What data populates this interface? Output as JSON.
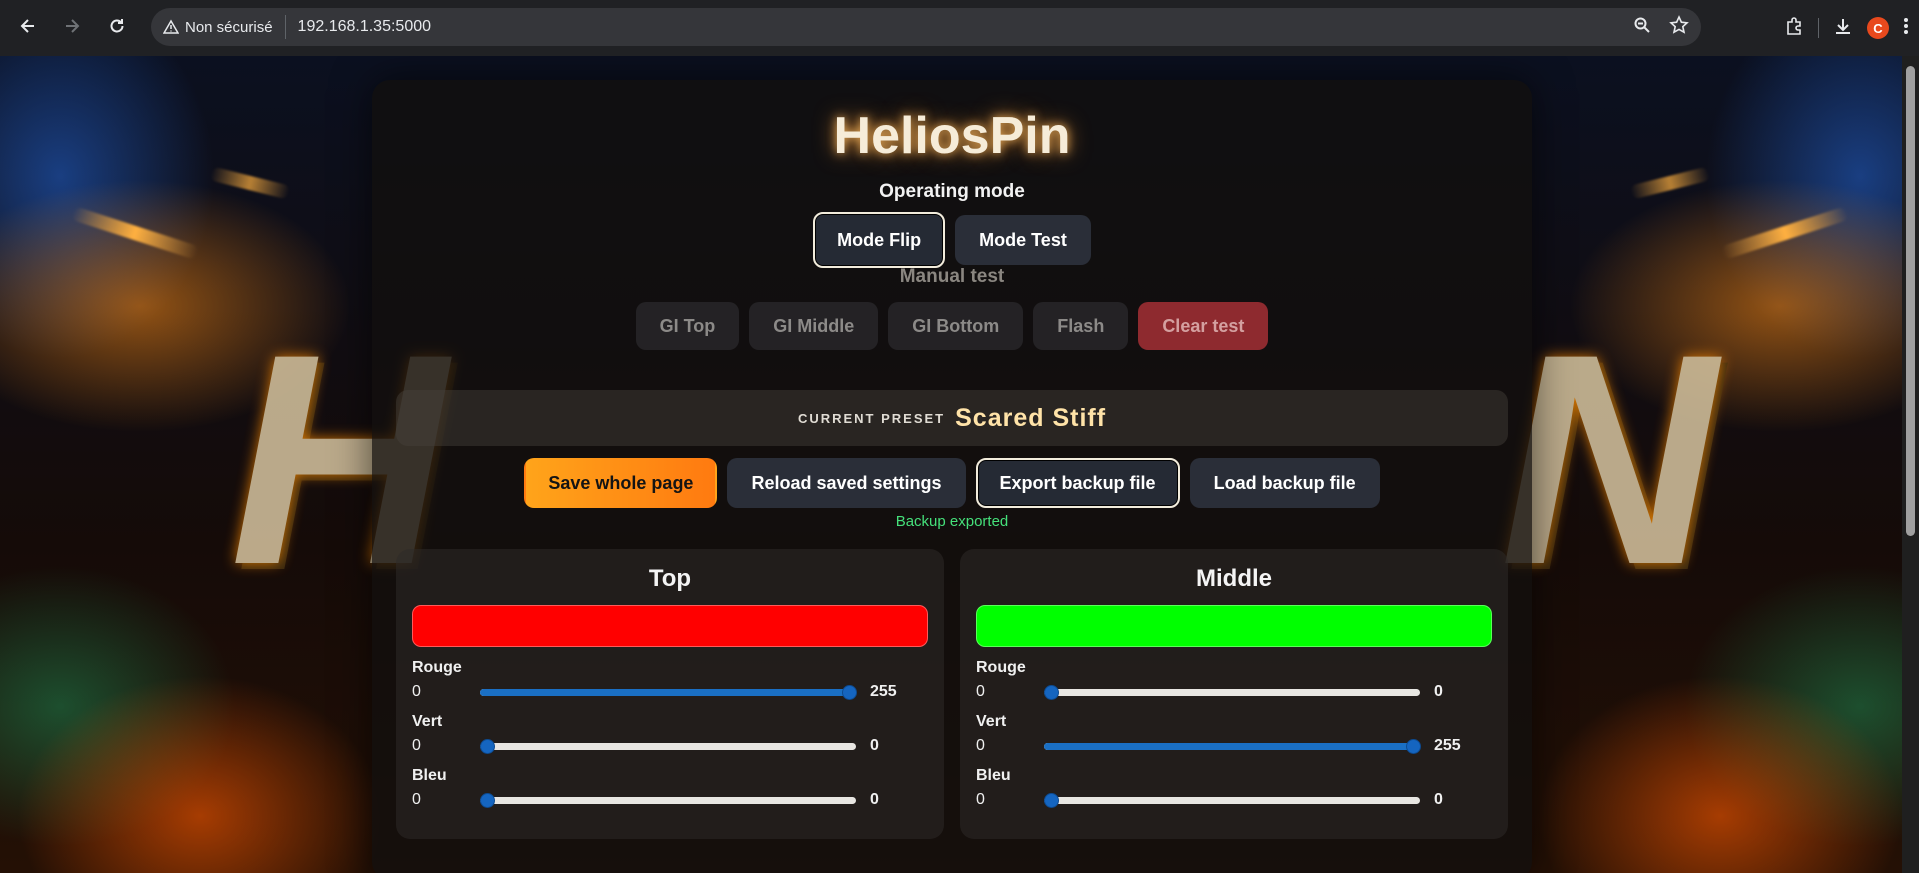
{
  "browser": {
    "security_label": "Non sécurisé",
    "url": "192.168.1.35:5000",
    "profile_initial": "C"
  },
  "page": {
    "title": "HeliosPin",
    "operating_mode_label": "Operating mode",
    "mode_buttons": [
      {
        "label": "Mode Flip",
        "active": true
      },
      {
        "label": "Mode Test",
        "active": false
      }
    ],
    "manual_test_label": "Manual test",
    "test_buttons": [
      "GI Top",
      "GI Middle",
      "GI Bottom",
      "Flash",
      "Clear test"
    ],
    "preset": {
      "label": "CURRENT PRESET",
      "name": "Scared Stiff"
    },
    "actions": [
      "Save whole page",
      "Reload saved settings",
      "Export backup file",
      "Load backup file"
    ],
    "status": "Backup exported"
  },
  "cards": [
    {
      "title": "Top",
      "color": "#ff0000",
      "channels": [
        {
          "label": "Rouge",
          "min": "0",
          "value": 255,
          "max": 255
        },
        {
          "label": "Vert",
          "min": "0",
          "value": 0,
          "max": 255
        },
        {
          "label": "Bleu",
          "min": "0",
          "value": 0,
          "max": 255
        }
      ]
    },
    {
      "title": "Middle",
      "color": "#00ff00",
      "channels": [
        {
          "label": "Rouge",
          "min": "0",
          "value": 0,
          "max": 255
        },
        {
          "label": "Vert",
          "min": "0",
          "value": 255,
          "max": 255
        },
        {
          "label": "Bleu",
          "min": "0",
          "value": 0,
          "max": 255
        }
      ]
    }
  ],
  "colors": {
    "accent_orange": "#ff8c14",
    "slider_blue": "#1565c0",
    "status_green": "#45e07a",
    "clear_red": "#8e2a2f"
  }
}
